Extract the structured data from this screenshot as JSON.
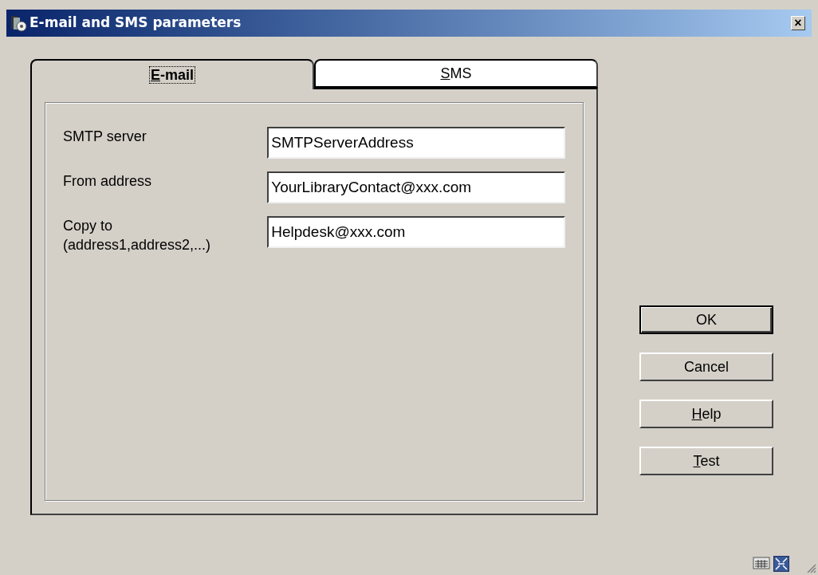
{
  "window": {
    "title": "E-mail and SMS parameters",
    "close": "×"
  },
  "tabs": [
    {
      "label": "E-mail",
      "selected": true,
      "mnemonic": true
    },
    {
      "label": "SMS",
      "selected": false,
      "mnemonic": true
    }
  ],
  "fields": [
    {
      "label": "SMTP server",
      "value": "SMTPServerAddress"
    },
    {
      "label": "From address",
      "value": "YourLibraryContact@xxx.com"
    },
    {
      "label": "Copy to\n(address1,address2,...)",
      "value": "Helpdesk@xxx.com"
    }
  ],
  "buttons": [
    {
      "label": "OK",
      "default": true,
      "mnemonic": false
    },
    {
      "label": "Cancel",
      "default": false,
      "mnemonic": false
    },
    {
      "label": "Help",
      "default": false,
      "mnemonic": true
    },
    {
      "label": "Test",
      "default": false,
      "mnemonic": true
    }
  ]
}
